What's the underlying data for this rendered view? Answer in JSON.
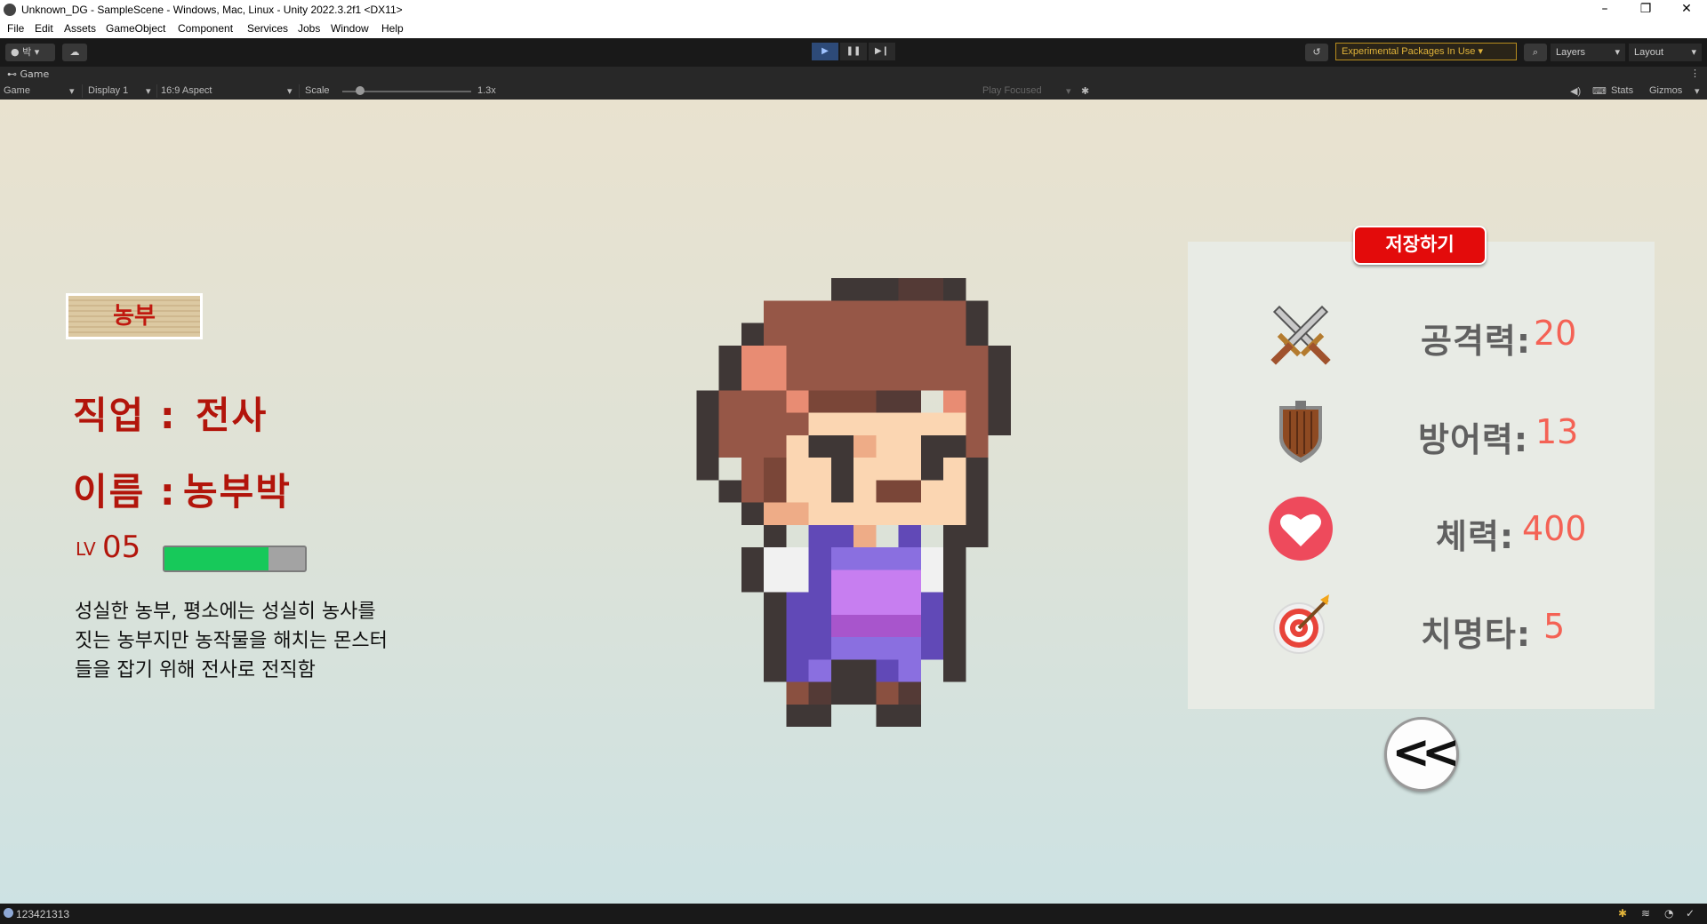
{
  "window": {
    "title": "Unknown_DG - SampleScene - Windows, Mac, Linux - Unity 2022.3.2f1 <DX11>",
    "controls": [
      "–",
      "❐",
      "✕"
    ]
  },
  "menu": [
    "File",
    "Edit",
    "Assets",
    "GameObject",
    "Component",
    "Services",
    "Jobs",
    "Window",
    "Help"
  ],
  "toolbar": {
    "account_label": "박",
    "play_icon": "play-icon",
    "pause_icon": "pause-icon",
    "step_icon": "step-icon",
    "experimental": "Experimental Packages In Use",
    "layers": "Layers",
    "layout": "Layout"
  },
  "game_tab": {
    "title": "Game",
    "view_mode": "Game",
    "display": "Display 1",
    "aspect": "16:9 Aspect",
    "scale_label": "Scale",
    "scale_value": "1.3x",
    "play_focused": "Play Focused",
    "stats": "Stats",
    "gizmos": "Gizmos"
  },
  "game": {
    "badge": "농부",
    "job_label": "직업 :",
    "job_value": "전사",
    "name_label": "이름 :",
    "name_value": "농부박",
    "level_prefix": "LV",
    "level_value": "05",
    "xp_fraction": 0.74,
    "description": "성실한 농부, 평소에는 성실히 농사를\n짓는 농부지만 농작물을 해치는 몬스터\n들을 잡기 위해 전사로 전직함",
    "save_button": "저장하기",
    "back_button": "<<",
    "stats": [
      {
        "icon": "crossed-swords-icon",
        "label": "공격력:",
        "value": "20"
      },
      {
        "icon": "wooden-shield-icon",
        "label": "방어력:",
        "value": "13"
      },
      {
        "icon": "heart-icon",
        "label": "체력:",
        "value": "400"
      },
      {
        "icon": "target-icon",
        "label": "치명타:",
        "value": "5"
      }
    ]
  },
  "status": {
    "message": "123421313"
  }
}
